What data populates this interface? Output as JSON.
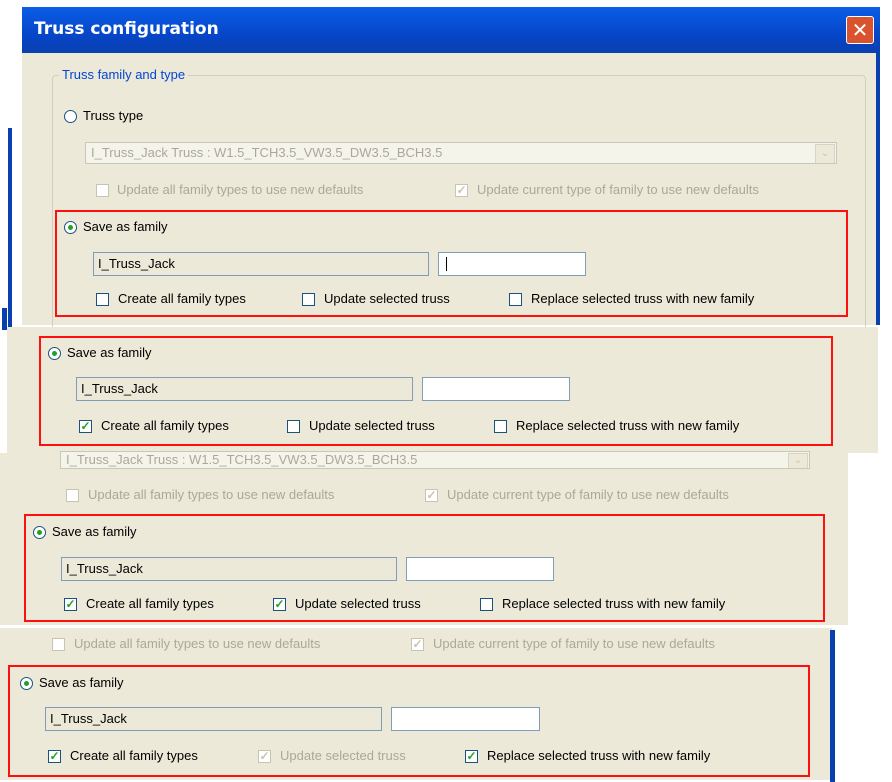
{
  "window": {
    "title": "Truss configuration",
    "close_glyph": "✕"
  },
  "group_legend": "Truss family and type",
  "truss_type": {
    "label": "Truss type",
    "combo_value": "I_Truss_Jack Truss : W1.5_TCH3.5_VW3.5_DW3.5_BCH3.5",
    "arrow_glyph": "⌄",
    "update_all_label": "Update all family types to use new defaults",
    "update_current_label": "Update current type of family to use new defaults"
  },
  "save_as_family": {
    "label": "Save as family",
    "name_value": "I_Truss_Jack",
    "create_all_label": "Create all family types",
    "update_selected_label": "Update selected truss",
    "replace_selected_label": "Replace selected truss with new family"
  },
  "check_glyph": "✓",
  "panels": [
    {
      "create_all": false,
      "update_selected": false,
      "update_selected_disabled": false,
      "replace": false
    },
    {
      "create_all": true,
      "update_selected": false,
      "update_selected_disabled": false,
      "replace": false
    },
    {
      "create_all": true,
      "update_selected": true,
      "update_selected_disabled": false,
      "replace": false
    },
    {
      "create_all": true,
      "update_selected": false,
      "update_selected_disabled": true,
      "replace": true
    }
  ],
  "colors": {
    "title_bar": "#0646c8",
    "dialog_bg": "#ece9d8",
    "highlight": "#ff1010",
    "legend": "#0046d5"
  }
}
